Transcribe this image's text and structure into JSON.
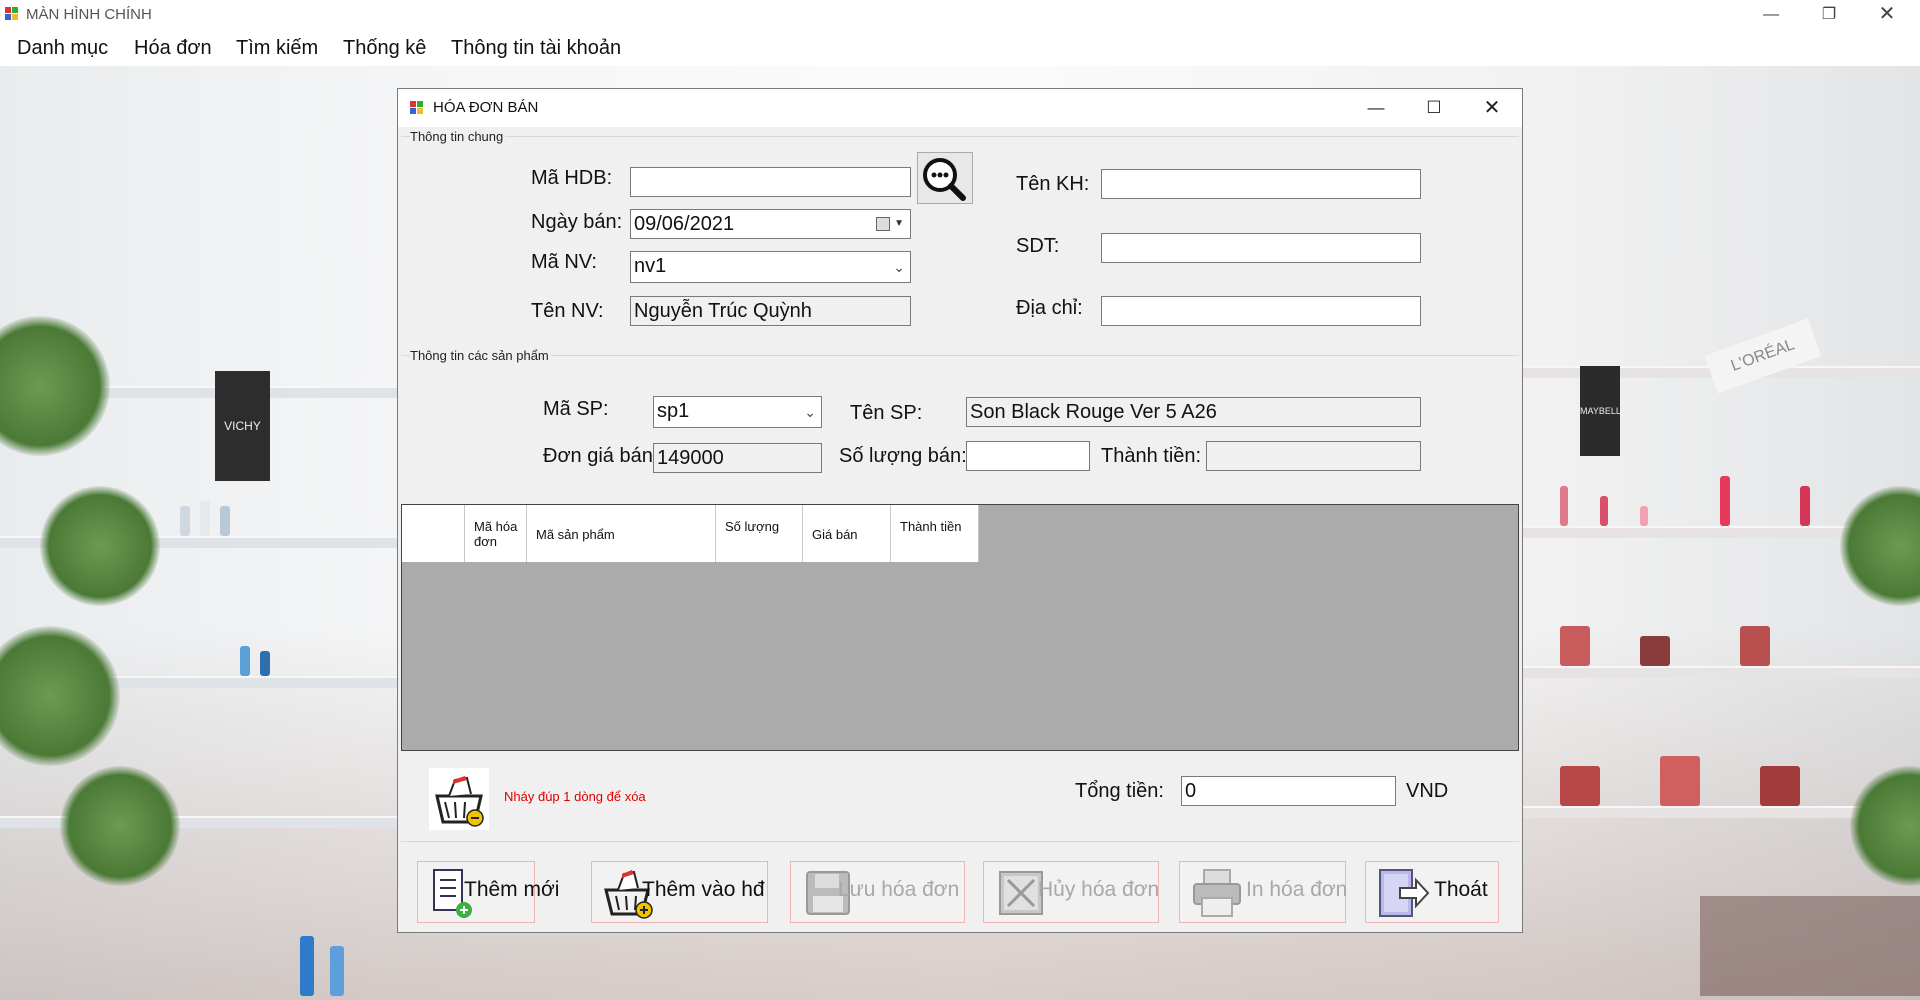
{
  "window": {
    "title": "MÀN HÌNH CHÍNH",
    "minimize_icon": "minimize-icon",
    "restore_icon": "restore-icon",
    "close_icon": "close-icon"
  },
  "menu": {
    "items": [
      "Danh mục",
      "Hóa đơn",
      "Tìm kiếm",
      "Thống kê",
      "Thông tin tài khoản"
    ]
  },
  "background_signs": {
    "left": "VICHY",
    "right": "L'ORÉAL",
    "right2": "MAYBELLINE"
  },
  "dialog": {
    "title": "HÓA ĐƠN BÁN",
    "general_group": "Thông tin chung",
    "products_group": "Thông tin các sản phẩm",
    "labels": {
      "ma_hdb": "Mã HDB:",
      "ngay_ban": "Ngày bán:",
      "ma_nv": "Mã NV:",
      "ten_nv": "Tên NV:",
      "ten_kh": "Tên KH:",
      "sdt": "SDT:",
      "dia_chi": "Địa chỉ:",
      "ma_sp": "Mã SP:",
      "ten_sp": "Tên SP:",
      "don_gia_ban": "Đơn giá bán:",
      "so_luong_ban": "Số lượng bán:",
      "thanh_tien": "Thành tiền:",
      "tong_tien": "Tổng tiền:",
      "currency": "VND"
    },
    "values": {
      "ma_hdb": "",
      "ngay_ban": "09/06/2021",
      "ma_nv": "nv1",
      "ten_nv": "Nguyễn Trúc Quỳnh",
      "ten_kh": "",
      "sdt": "",
      "dia_chi": "",
      "ma_sp": "sp1",
      "ten_sp": "Son Black Rouge Ver 5 A26",
      "don_gia_ban": "149000",
      "so_luong_ban": "",
      "thanh_tien": "",
      "tong_tien": "0"
    },
    "grid_columns": [
      "Mã hóa đơn",
      "Mã sản phẩm",
      "Số lượng",
      "Giá bán",
      "Thành tiền"
    ],
    "delete_hint": "Nháy đúp 1 dòng để xóa",
    "buttons": {
      "them_moi": "Thêm mới",
      "them_vao_hd": "Thêm vào hđ",
      "luu_hoa_don": "Lưu hóa đơn",
      "huy_hoa_don": "Hủy hóa đơn",
      "in_hoa_don": "In hóa đơn",
      "thoat": "Thoát"
    },
    "accent_colors": {
      "hint_red": "#e00000",
      "button_border": "#f0b4b4"
    }
  }
}
